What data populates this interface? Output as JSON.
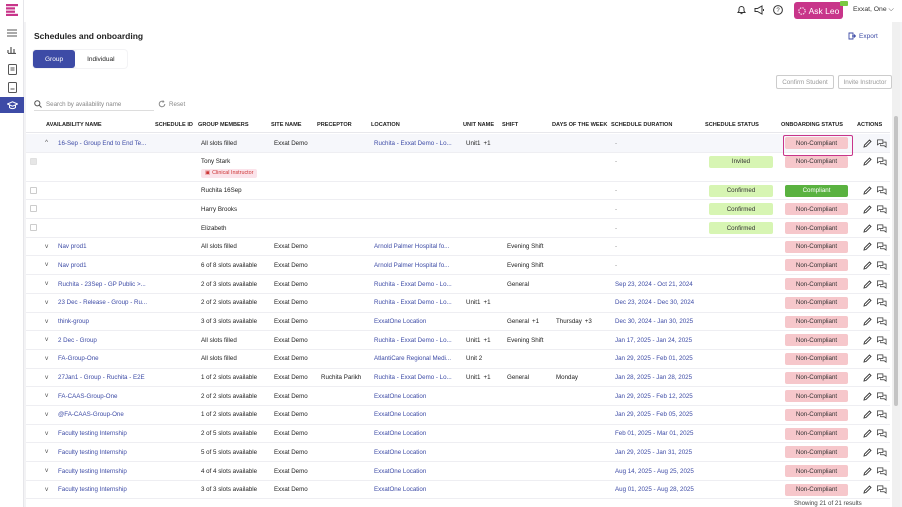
{
  "colors": {
    "accent": "#3d4ba6",
    "ask_leo": "#c8358a",
    "beta_badge": "#7ac943",
    "invited": "#d7f5b3",
    "non_compliant": "#f6c7cb",
    "compliant": "#5ab240"
  },
  "topbar": {
    "ask_leo": "Ask Leo",
    "user": "Exxat, One",
    "icons": [
      "bell-icon",
      "megaphone-icon",
      "help-icon",
      "chevron-down-icon"
    ]
  },
  "page": {
    "title": "Schedules and onboarding",
    "export": "Export"
  },
  "tabs": [
    "Group",
    "Individual"
  ],
  "buttons": {
    "confirm_student": "Confirm Student",
    "invite_instructor": "Invite Instructor"
  },
  "search": {
    "placeholder": "Search by availability name",
    "reset": "Reset"
  },
  "columns": [
    "AVAILABILITY NAME",
    "SCHEDULE ID",
    "GROUP MEMBERS",
    "SITE NAME",
    "PRECEPTOR",
    "LOCATION",
    "UNIT NAME",
    "SHIFT",
    "DAYS OF THE WEEK",
    "SCHEDULE DURATION",
    "SCHEDULE STATUS",
    "ONBOARDING STATUS",
    "ACTIONS"
  ],
  "rows": [
    {
      "kind": "group",
      "chev": "^",
      "name": "16-Sep - Group End to End Te...",
      "members": "All slots filled",
      "site": "Exxat Demo",
      "preceptor": "",
      "location": "Ruchita - Exxat Demo - Lo...",
      "unit": "Unit1",
      "unit_more": "+1",
      "shift": "",
      "shift_more": "",
      "days": "",
      "days_more": "",
      "duration": "-",
      "sched_status": "",
      "onboarding": "Non-Compliant"
    },
    {
      "kind": "member",
      "member": "Tony Stark",
      "tag": "Clinical Instructor",
      "duration": "-",
      "sched_status": "Invited",
      "onboarding": "Non-Compliant",
      "disabled": true
    },
    {
      "kind": "member",
      "member": "Ruchita 16Sep",
      "tag": "",
      "duration": "-",
      "sched_status": "Confirmed",
      "onboarding": "Compliant"
    },
    {
      "kind": "member",
      "member": "Harry Brooks",
      "tag": "",
      "duration": "-",
      "sched_status": "Confirmed",
      "onboarding": "Non-Compliant"
    },
    {
      "kind": "member",
      "member": "Elizabeth",
      "tag": "",
      "duration": "-",
      "sched_status": "Confirmed",
      "onboarding": "Non-Compliant"
    },
    {
      "kind": "group",
      "chev": "v",
      "name": "Nav prod1",
      "members": "All slots filled",
      "site": "Exxat Demo",
      "preceptor": "",
      "location": "Arnold Palmer Hospital fo...",
      "unit": "",
      "unit_more": "",
      "shift": "Evening Shift",
      "shift_more": "",
      "days": "",
      "days_more": "",
      "duration": "-",
      "sched_status": "",
      "onboarding": "Non-Compliant"
    },
    {
      "kind": "group",
      "chev": "v",
      "name": "Nav prod1",
      "members": "6 of 8 slots available",
      "site": "Exxat Demo",
      "preceptor": "",
      "location": "Arnold Palmer Hospital fo...",
      "unit": "",
      "unit_more": "",
      "shift": "Evening Shift",
      "shift_more": "",
      "days": "",
      "days_more": "",
      "duration": "-",
      "sched_status": "",
      "onboarding": "Non-Compliant"
    },
    {
      "kind": "group",
      "chev": "v",
      "name": "Ruchita - 23Sep - GP Public >...",
      "members": "2 of 3 slots available",
      "site": "Exxat Demo",
      "preceptor": "",
      "location": "Ruchita - Exxat Demo - Lo...",
      "unit": "",
      "unit_more": "",
      "shift": "General",
      "shift_more": "",
      "days": "",
      "days_more": "",
      "duration": "Sep 23, 2024 - Oct 21, 2024",
      "sched_status": "",
      "onboarding": "Non-Compliant"
    },
    {
      "kind": "group",
      "chev": "v",
      "name": "23 Dec - Release - Group - Ru...",
      "members": "2 of 2 slots available",
      "site": "Exxat Demo",
      "preceptor": "",
      "location": "Ruchita - Exxat Demo - Lo...",
      "unit": "Unit1",
      "unit_more": "+1",
      "shift": "",
      "shift_more": "",
      "days": "",
      "days_more": "",
      "duration": "Dec 23, 2024 - Dec 30, 2024",
      "sched_status": "",
      "onboarding": "Non-Compliant"
    },
    {
      "kind": "group",
      "chev": "v",
      "name": "think-group",
      "members": "3 of 3 slots available",
      "site": "Exxat Demo",
      "preceptor": "",
      "location": "ExxatOne Location",
      "unit": "",
      "unit_more": "",
      "shift": "General",
      "shift_more": "+1",
      "days": "Thursday",
      "days_more": "+3",
      "duration": "Dec 30, 2024 - Jan 30, 2025",
      "sched_status": "",
      "onboarding": "Non-Compliant"
    },
    {
      "kind": "group",
      "chev": "v",
      "name": "2 Dec - Group",
      "members": "All slots filled",
      "site": "Exxat Demo",
      "preceptor": "",
      "location": "Ruchita - Exxat Demo - Lo...",
      "unit": "Unit1",
      "unit_more": "+1",
      "shift": "Evening Shift",
      "shift_more": "",
      "days": "",
      "days_more": "",
      "duration": "Jan 17, 2025 - Jan 24, 2025",
      "sched_status": "",
      "onboarding": "Non-Compliant"
    },
    {
      "kind": "group",
      "chev": "v",
      "name": "FA-Group-One",
      "members": "All slots filled",
      "site": "Exxat Demo",
      "preceptor": "",
      "location": "AtlantiCare Regional Medi...",
      "unit": "Unit 2",
      "unit_more": "",
      "shift": "",
      "shift_more": "",
      "days": "",
      "days_more": "",
      "duration": "Jan 29, 2025 - Feb 01, 2025",
      "sched_status": "",
      "onboarding": "Non-Compliant"
    },
    {
      "kind": "group",
      "chev": "v",
      "name": "27Jan1 - Group - Ruchita - E2E",
      "members": "1 of 2 slots available",
      "site": "Exxat Demo",
      "preceptor": "Ruchita Parikh",
      "location": "Ruchita - Exxat Demo - Lo...",
      "unit": "Unit1",
      "unit_more": "+1",
      "shift": "General",
      "shift_more": "",
      "days": "Monday",
      "days_more": "",
      "duration": "Jan 28, 2025 - Jan 28, 2025",
      "sched_status": "",
      "onboarding": "Non-Compliant"
    },
    {
      "kind": "group",
      "chev": "v",
      "name": "FA-CAAS-Group-One",
      "members": "2 of 2 slots available",
      "site": "Exxat Demo",
      "preceptor": "",
      "location": "ExxatOne Location",
      "unit": "",
      "unit_more": "",
      "shift": "",
      "shift_more": "",
      "days": "",
      "days_more": "",
      "duration": "Jan 29, 2025 - Feb 12, 2025",
      "sched_status": "",
      "onboarding": "Non-Compliant"
    },
    {
      "kind": "group",
      "chev": "v",
      "name": "@FA-CAAS-Group-One",
      "members": "1 of 2 slots available",
      "site": "Exxat Demo",
      "preceptor": "",
      "location": "ExxatOne Location",
      "unit": "",
      "unit_more": "",
      "shift": "",
      "shift_more": "",
      "days": "",
      "days_more": "",
      "duration": "Jan 29, 2025 - Feb 05, 2025",
      "sched_status": "",
      "onboarding": "Non-Compliant"
    },
    {
      "kind": "group",
      "chev": "v",
      "name": "Faculty testing Internship",
      "members": "2 of 5 slots available",
      "site": "Exxat Demo",
      "preceptor": "",
      "location": "ExxatOne Location",
      "unit": "",
      "unit_more": "",
      "shift": "",
      "shift_more": "",
      "days": "",
      "days_more": "",
      "duration": "Feb 01, 2025 - Mar 01, 2025",
      "sched_status": "",
      "onboarding": "Non-Compliant"
    },
    {
      "kind": "group",
      "chev": "v",
      "name": "Faculty testing Internship",
      "members": "5 of 5 slots available",
      "site": "Exxat Demo",
      "preceptor": "",
      "location": "ExxatOne Location",
      "unit": "",
      "unit_more": "",
      "shift": "",
      "shift_more": "",
      "days": "",
      "days_more": "",
      "duration": "Jan 29, 2025 - Jan 31, 2025",
      "sched_status": "",
      "onboarding": "Non-Compliant"
    },
    {
      "kind": "group",
      "chev": "v",
      "name": "Faculty testing Internship",
      "members": "4 of 4 slots available",
      "site": "Exxat Demo",
      "preceptor": "",
      "location": "ExxatOne Location",
      "unit": "",
      "unit_more": "",
      "shift": "",
      "shift_more": "",
      "days": "",
      "days_more": "",
      "duration": "Aug 14, 2025 - Aug 25, 2025",
      "sched_status": "",
      "onboarding": "Non-Compliant"
    },
    {
      "kind": "group",
      "chev": "v",
      "name": "Faculty testing Internship",
      "members": "3 of 3 slots available",
      "site": "Exxat Demo",
      "preceptor": "",
      "location": "ExxatOne Location",
      "unit": "",
      "unit_more": "",
      "shift": "",
      "shift_more": "",
      "days": "",
      "days_more": "",
      "duration": "Aug 01, 2025 - Aug 28, 2025",
      "sched_status": "",
      "onboarding": "Non-Compliant"
    }
  ],
  "footer": "Showing 21 of 21 results"
}
